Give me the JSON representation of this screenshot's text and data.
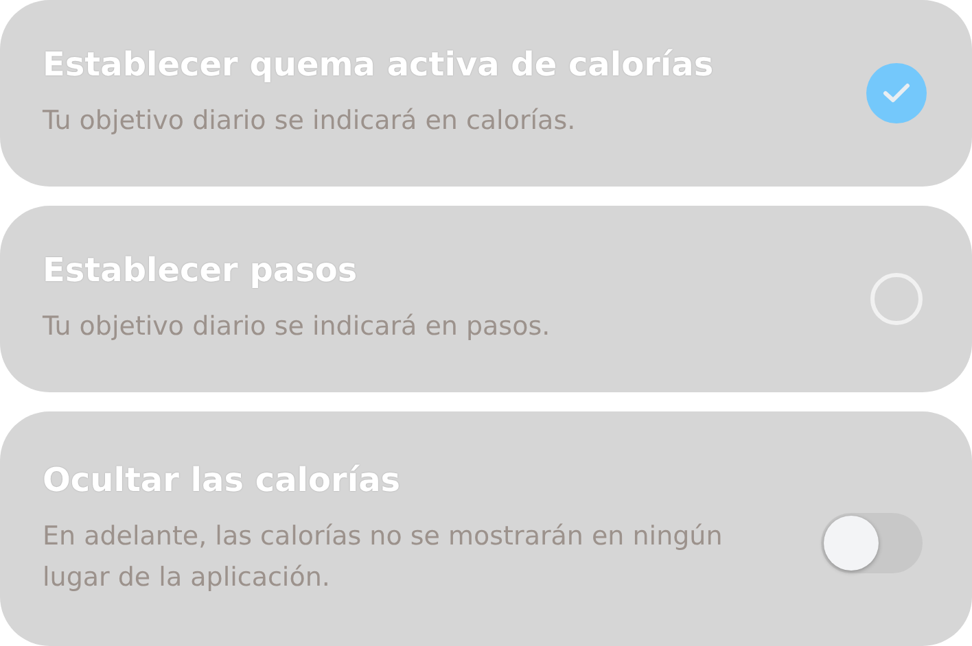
{
  "options": [
    {
      "kind": "radio",
      "title": "Establecer quema activa de calorías",
      "description": "Tu objetivo diario se indicará en calorías.",
      "selected": true
    },
    {
      "kind": "radio",
      "title": "Establecer pasos",
      "description": "Tu objetivo diario se indicará en pasos.",
      "selected": false
    },
    {
      "kind": "toggle",
      "title": "Ocultar las calorías",
      "description": "En adelante, las calorías no se mostrarán en ningún lugar de la aplicación.",
      "on": false
    }
  ]
}
